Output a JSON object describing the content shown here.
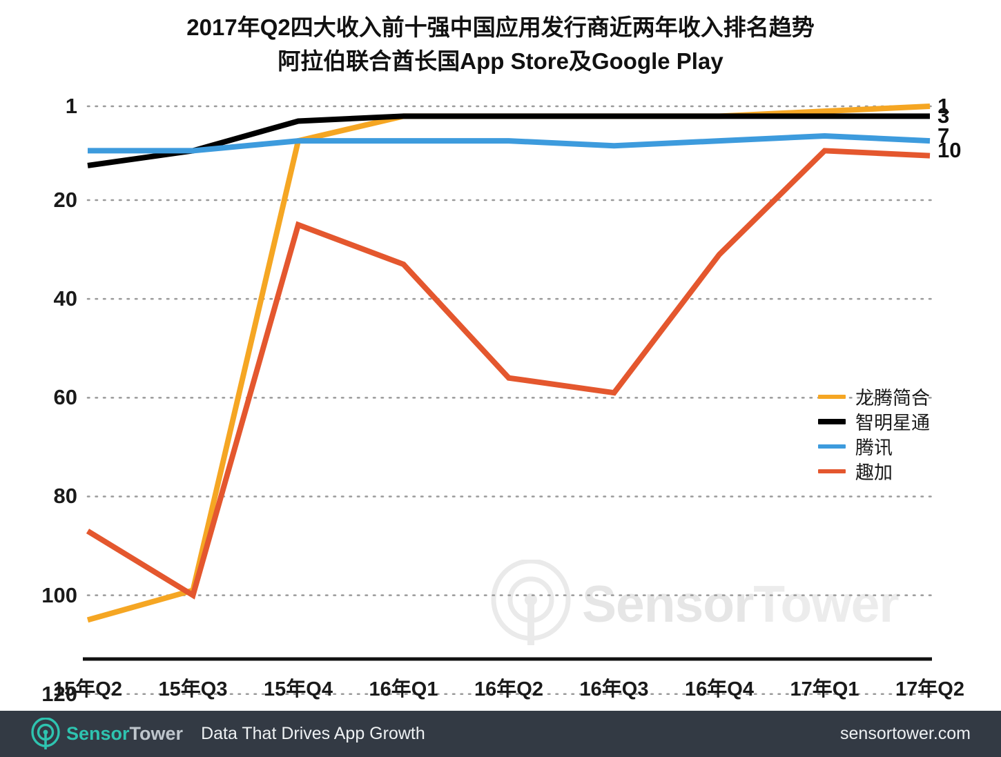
{
  "title": {
    "line1": "2017年Q2四大收入前十强中国应用发行商近两年收入排名趋势",
    "line2": "阿拉伯联合酋长国App Store及Google Play"
  },
  "watermark": {
    "sensor": "Sensor",
    "tower": "Tower",
    "logo_icon": "sensortower-logo-icon"
  },
  "footer": {
    "logo_icon": "sensortower-logo-icon",
    "brand_sensor": "Sensor",
    "brand_tower": "Tower",
    "tagline": "Data That Drives App Growth",
    "url": "sensortower.com",
    "background": "#333a44",
    "accent": "#2ec4b0"
  },
  "end_labels": [
    {
      "text": "1",
      "rank": 1,
      "color": "#f5a623",
      "series": "龙腾简合"
    },
    {
      "text": "3",
      "rank": 3,
      "color": "#000000",
      "series": "智明星通"
    },
    {
      "text": "7",
      "rank": 7,
      "color": "#3d9bdd",
      "series": "腾讯"
    },
    {
      "text": "10",
      "rank": 10,
      "color": "#e4572e",
      "series": "趣加"
    }
  ],
  "chart_data": {
    "type": "line",
    "title": "2017年Q2四大收入前十强中国应用发行商近两年收入排名趋势",
    "subtitle": "阿拉伯联合酋长国App Store及Google Play",
    "xlabel": "",
    "ylabel": "",
    "categories": [
      "15年Q2",
      "15年Q3",
      "15年Q4",
      "16年Q1",
      "16年Q2",
      "16年Q3",
      "16年Q4",
      "17年Q1",
      "17年Q2"
    ],
    "yticks": [
      1,
      20,
      40,
      60,
      80,
      100,
      120
    ],
    "ylim": [
      1,
      120
    ],
    "y_inverted": true,
    "grid": "horizontal-dotted",
    "legend_position": "right-middle",
    "series": [
      {
        "name": "龙腾简合",
        "color": "#f5a623",
        "values": [
          105,
          99,
          8,
          3,
          3,
          3,
          3,
          2,
          1
        ]
      },
      {
        "name": "智明星通",
        "color": "#000000",
        "values": [
          13,
          10,
          4,
          3,
          3,
          3,
          3,
          3,
          3
        ]
      },
      {
        "name": "腾讯",
        "color": "#3d9bdd",
        "values": [
          10,
          10,
          8,
          8,
          8,
          9,
          8,
          7,
          8
        ]
      },
      {
        "name": "趣加",
        "color": "#e4572e",
        "values": [
          87,
          100,
          25,
          33,
          56,
          59,
          31,
          10,
          11
        ]
      }
    ]
  },
  "legend": {
    "items": [
      {
        "label": "龙腾简合",
        "color": "#f5a623"
      },
      {
        "label": "智明星通",
        "color": "#000000"
      },
      {
        "label": "腾讯",
        "color": "#3d9bdd"
      },
      {
        "label": "趣加",
        "color": "#e4572e"
      }
    ]
  }
}
